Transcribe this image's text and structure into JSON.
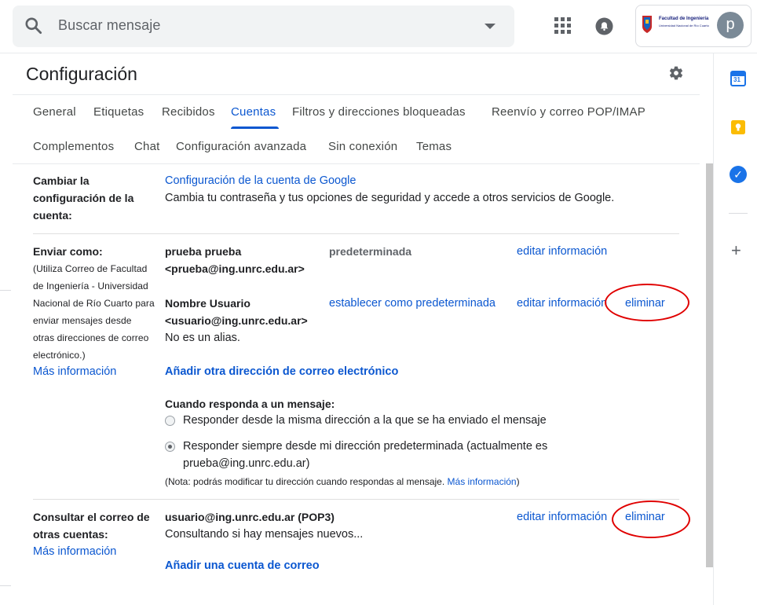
{
  "header": {
    "search_placeholder": "Buscar mensaje",
    "avatar_initial": "p",
    "logo_text": "Facultad de Ingeniería",
    "logo_subtext": "Universidad Nacional de Río Cuarto"
  },
  "settings": {
    "title": "Configuración",
    "tabs_row1": [
      "General",
      "Etiquetas",
      "Recibidos",
      "Cuentas",
      "Filtros y direcciones bloqueadas",
      "Reenvío y correo POP/IMAP"
    ],
    "tabs_row2": [
      "Complementos",
      "Chat",
      "Configuración avanzada",
      "Sin conexión",
      "Temas"
    ],
    "active_tab": "Cuentas"
  },
  "account_change": {
    "label_lines": [
      "Cambiar la",
      "configuración de la",
      "cuenta:"
    ],
    "link": "Configuración de la cuenta de Google",
    "description": "Cambia tu contraseña y tus opciones de seguridad y accede a otros servicios de Google."
  },
  "send_as": {
    "label": "Enviar como:",
    "note_lines": [
      "(Utiliza Correo de Facultad",
      "de Ingeniería - Universidad",
      "Nacional de Río Cuarto para",
      "enviar mensajes desde",
      "otras direcciones de correo",
      "electrónico.)"
    ],
    "more_info": "Más información",
    "entries": [
      {
        "name": "prueba prueba",
        "email": "<prueba@ing.unrc.edu.ar>",
        "status": "predeterminada",
        "edit": "editar información"
      },
      {
        "name": "Nombre Usuario",
        "email": "<usuario@ing.unrc.edu.ar>",
        "alias_note": "No es un alias.",
        "set_default": "establecer como predeterminada",
        "edit": "editar información",
        "delete": "eliminar"
      }
    ],
    "add_address": "Añadir otra dirección de correo electrónico",
    "reply_heading": "Cuando responda a un mensaje:",
    "reply_option1": "Responder desde la misma dirección a la que se ha enviado el mensaje",
    "reply_option2_line1": "Responder siempre desde mi dirección predeterminada (actualmente es",
    "reply_option2_line2": "prueba@ing.unrc.edu.ar)",
    "reply_note": "(Nota: podrás modificar tu dirección cuando respondas al mensaje.",
    "reply_note_link": "Más información",
    "reply_note_end": ")"
  },
  "check_mail": {
    "label_lines": [
      "Consultar el correo de",
      "otras cuentas:"
    ],
    "more_info": "Más información",
    "account": "usuario@ing.unrc.edu.ar (POP3)",
    "status": "Consultando si hay mensajes nuevos...",
    "edit": "editar información",
    "delete": "eliminar",
    "add_account": "Añadir una cuenta de correo"
  },
  "colors": {
    "link": "#0b57d0",
    "highlight_ellipse": "#e00000"
  }
}
